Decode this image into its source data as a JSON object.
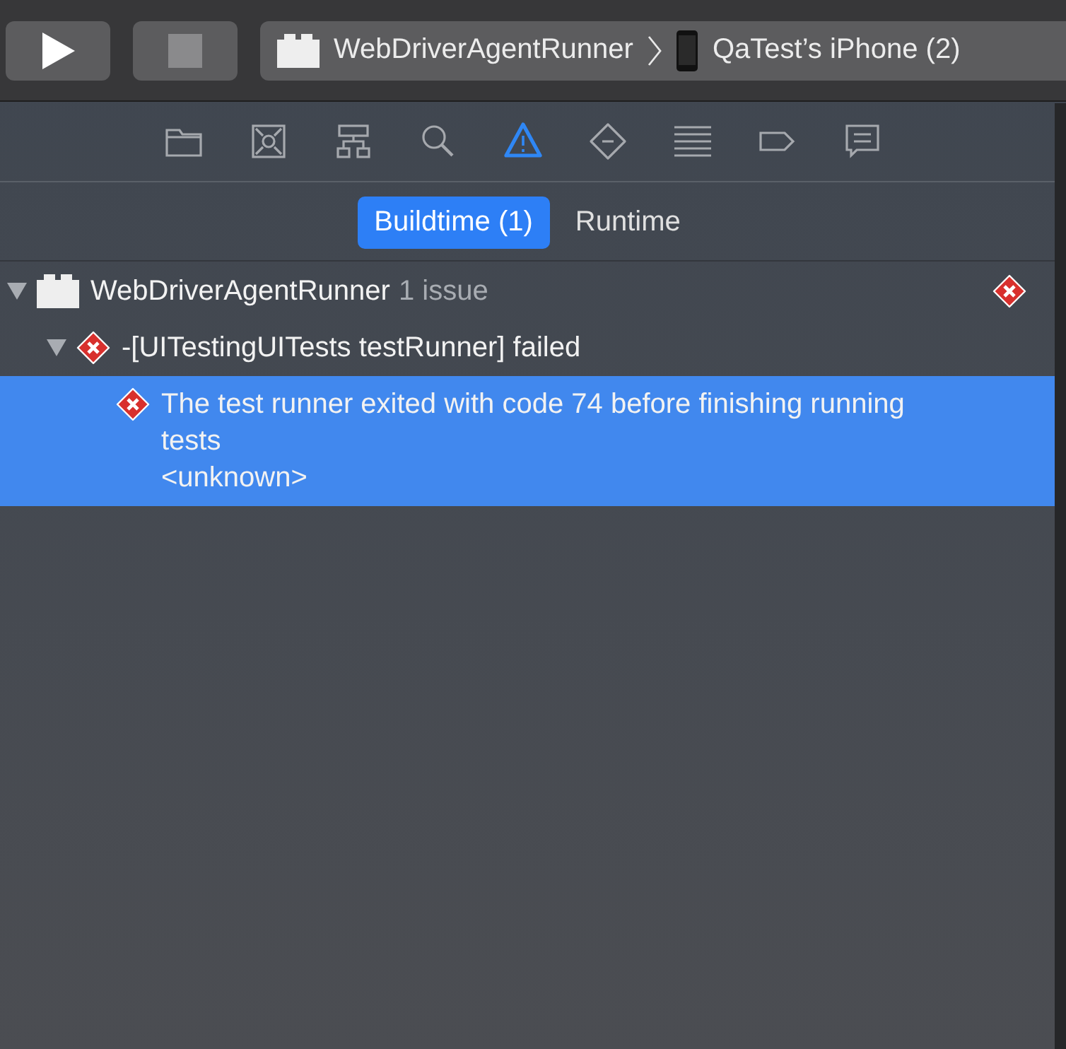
{
  "toolbar": {
    "run_button": {
      "disabled": false
    },
    "stop_button": {
      "disabled": true
    },
    "scheme": {
      "target": "WebDriverAgentRunner",
      "device": "QaTest’s iPhone (2)"
    }
  },
  "navigator_tabs": [
    {
      "kind": "folder",
      "selected": false
    },
    {
      "kind": "symbol",
      "selected": false
    },
    {
      "kind": "hierarchy",
      "selected": false
    },
    {
      "kind": "search",
      "selected": false
    },
    {
      "kind": "warning",
      "selected": true
    },
    {
      "kind": "test",
      "selected": false
    },
    {
      "kind": "debug",
      "selected": false
    },
    {
      "kind": "breakpoint",
      "selected": false
    },
    {
      "kind": "report",
      "selected": false
    }
  ],
  "segments": [
    {
      "label": "Buildtime (1)",
      "selected": true
    },
    {
      "label": "Runtime",
      "selected": false
    }
  ],
  "issues": [
    {
      "kind": "target",
      "title": "WebDriverAgentRunner",
      "detail": "1 issue",
      "error": true,
      "expanded": true,
      "selected": false,
      "children": [
        {
          "kind": "issue",
          "title": "-[UITestingUITests testRunner] failed",
          "error": true,
          "expanded": true,
          "selected": false,
          "children": [
            {
              "kind": "issue",
              "title": "The test runner exited with code 74 before finishing running tests",
              "location": "<unknown>",
              "error": true,
              "selected": true
            }
          ]
        }
      ]
    }
  ]
}
